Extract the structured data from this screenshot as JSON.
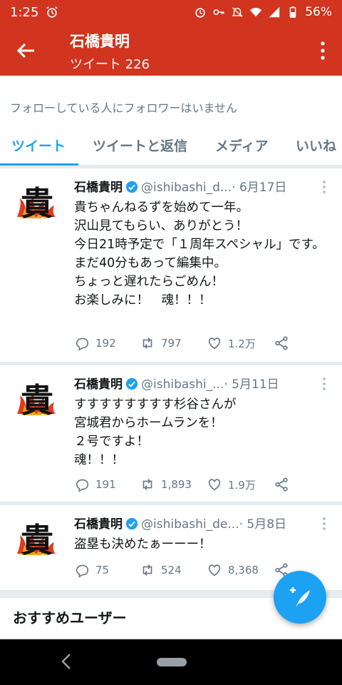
{
  "status_bar": {
    "time": "1:25",
    "battery": "56%"
  },
  "header": {
    "title": "石橋貴明",
    "subtitle": "ツイート 226"
  },
  "follow_note": "フォローしている人にフォロワーはいません",
  "tabs": [
    "ツイート",
    "ツイートと返信",
    "メディア",
    "いいね"
  ],
  "tweets": [
    {
      "name": "石橋貴明",
      "handle": "@ishibashi_d...",
      "date": "· 6月17日",
      "lines": [
        "貴ちゃんねるずを始めて一年。",
        "沢山見てもらい、ありがとう！",
        "今日21時予定で「１周年スペシャル」です。",
        "まだ40分もあって編集中。",
        "ちょっと遅れたらごめん！",
        "お楽しみに！　魂！！！"
      ],
      "replies": "192",
      "retweets": "797",
      "likes": "1.2万"
    },
    {
      "name": "石橋貴明",
      "handle": "@ishibashi_...",
      "date": "· 5月11日",
      "lines": [
        "すすすすすすすす杉谷さんが",
        "宮城君からホームランを！",
        "２号ですよ！",
        "魂！！！"
      ],
      "replies": "191",
      "retweets": "1,893",
      "likes": "1.9万"
    },
    {
      "name": "石橋貴明",
      "handle": "@ishibashi_de...",
      "date": "· 5月8日",
      "lines": [
        "盗塁も決めたぁーーー！"
      ],
      "replies": "75",
      "retweets": "524",
      "likes": "8,368"
    }
  ],
  "avatar_glyph": "貴",
  "recommended": "おすすめユーザー",
  "colors": {
    "brand": "#d1341f",
    "accent": "#1da1f2"
  },
  "icons": [
    "back-arrow-icon",
    "overflow-menu-icon",
    "verified-icon",
    "reply-icon",
    "retweet-icon",
    "like-icon",
    "share-icon",
    "compose-icon"
  ]
}
